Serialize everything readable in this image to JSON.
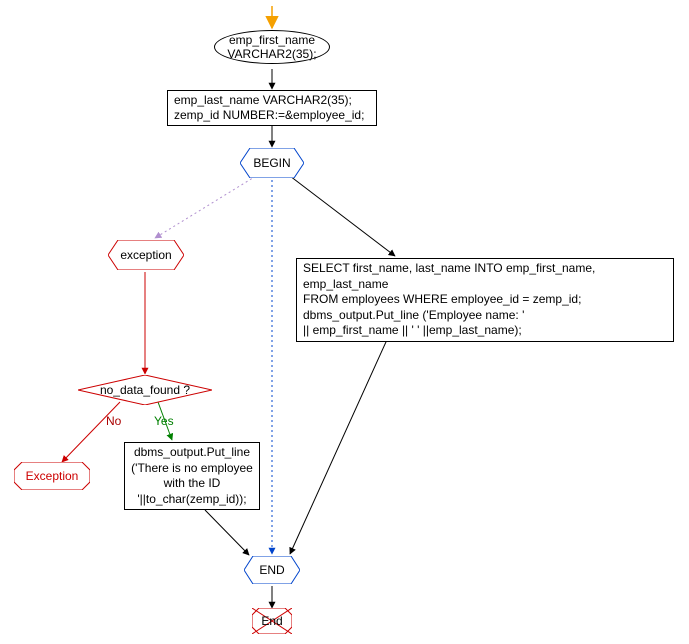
{
  "chart_data": {
    "type": "flowchart",
    "title": "",
    "nodes": [
      {
        "id": "start_decl",
        "shape": "ellipse",
        "text": "emp_first_name VARCHAR2(35);"
      },
      {
        "id": "decl2",
        "shape": "rect",
        "text": "emp_last_name  VARCHAR2(35);\nzemp_id NUMBER:=&employee_id;"
      },
      {
        "id": "begin",
        "shape": "hexagon",
        "text": "BEGIN",
        "stroke": "#0044cc"
      },
      {
        "id": "exception",
        "shape": "hexagon",
        "text": "exception",
        "stroke": "#cc0000"
      },
      {
        "id": "select",
        "shape": "rect",
        "text": "SELECT first_name, last_name INTO emp_first_name, emp_last_name\nFROM employees WHERE  employee_id = zemp_id;\ndbms_output.Put_line ('Employee name: '\n|| emp_first_name || ' ' ||emp_last_name);"
      },
      {
        "id": "nodata",
        "shape": "diamond",
        "text": "no_data_found ?",
        "stroke": "#cc0000"
      },
      {
        "id": "output_noemp",
        "shape": "rect",
        "text": "dbms_output.Put_line\n('There is no employee\nwith the ID\n'||to_char(zemp_id));"
      },
      {
        "id": "exc_oct",
        "shape": "octagon",
        "text": "Exception",
        "stroke": "#cc0000"
      },
      {
        "id": "end_hex",
        "shape": "hexagon",
        "text": "END",
        "stroke": "#0044cc"
      },
      {
        "id": "end_oct",
        "shape": "octagon",
        "text": "End",
        "stroke": "#cc0000"
      }
    ],
    "edges": [
      {
        "from": "entry_arrow",
        "to": "start_decl",
        "style": "solid",
        "head": "orange"
      },
      {
        "from": "start_decl",
        "to": "decl2",
        "style": "solid"
      },
      {
        "from": "decl2",
        "to": "begin",
        "style": "solid"
      },
      {
        "from": "begin",
        "to": "exception",
        "style": "dotted",
        "color": "#b08fcf"
      },
      {
        "from": "begin",
        "to": "select",
        "style": "solid"
      },
      {
        "from": "begin",
        "to": "end_hex",
        "style": "dotted",
        "color": "#0044cc"
      },
      {
        "from": "exception",
        "to": "nodata",
        "style": "solid",
        "color": "#cc0000"
      },
      {
        "from": "nodata",
        "to": "output_noemp",
        "label": "Yes",
        "style": "solid",
        "color": "#008000"
      },
      {
        "from": "nodata",
        "to": "exc_oct",
        "label": "No",
        "style": "solid",
        "color": "#cc0000"
      },
      {
        "from": "output_noemp",
        "to": "end_hex",
        "style": "solid"
      },
      {
        "from": "select",
        "to": "end_hex",
        "style": "solid"
      },
      {
        "from": "end_hex",
        "to": "end_oct",
        "style": "solid"
      }
    ],
    "edge_labels": {
      "no": "No",
      "yes": "Yes"
    }
  }
}
